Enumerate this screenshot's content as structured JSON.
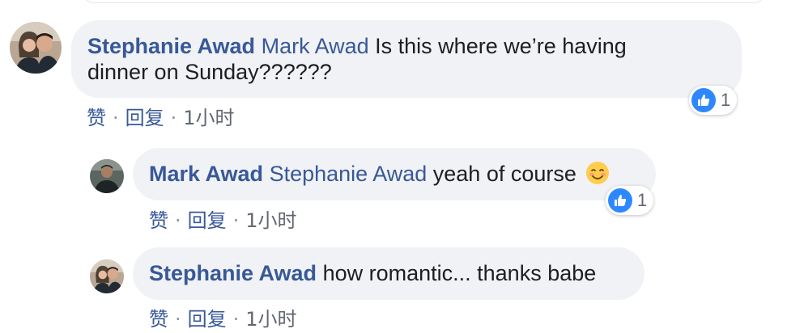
{
  "comments": [
    {
      "author": "Stephanie Awad",
      "mention": "Mark Awad",
      "text": "Is this where we’re having",
      "text2": "dinner on Sunday??????",
      "reaction_count": "1",
      "actions": {
        "like": "赞",
        "reply": "回复",
        "time": "1小时"
      }
    },
    {
      "author": "Mark Awad",
      "mention": "Stephanie Awad",
      "text": "yeah of course",
      "emoji": "smiling-face-emoji",
      "reaction_count": "1",
      "actions": {
        "like": "赞",
        "reply": "回复",
        "time": "1小时"
      }
    },
    {
      "author": "Stephanie Awad",
      "text": "how romantic... thanks babe",
      "actions": {
        "like": "赞",
        "reply": "回复",
        "time": "1小时"
      }
    }
  ],
  "separator": "·",
  "colors": {
    "name": "#385898",
    "bubble": "#f0f2f5",
    "like_blue": "#2d88ff"
  }
}
